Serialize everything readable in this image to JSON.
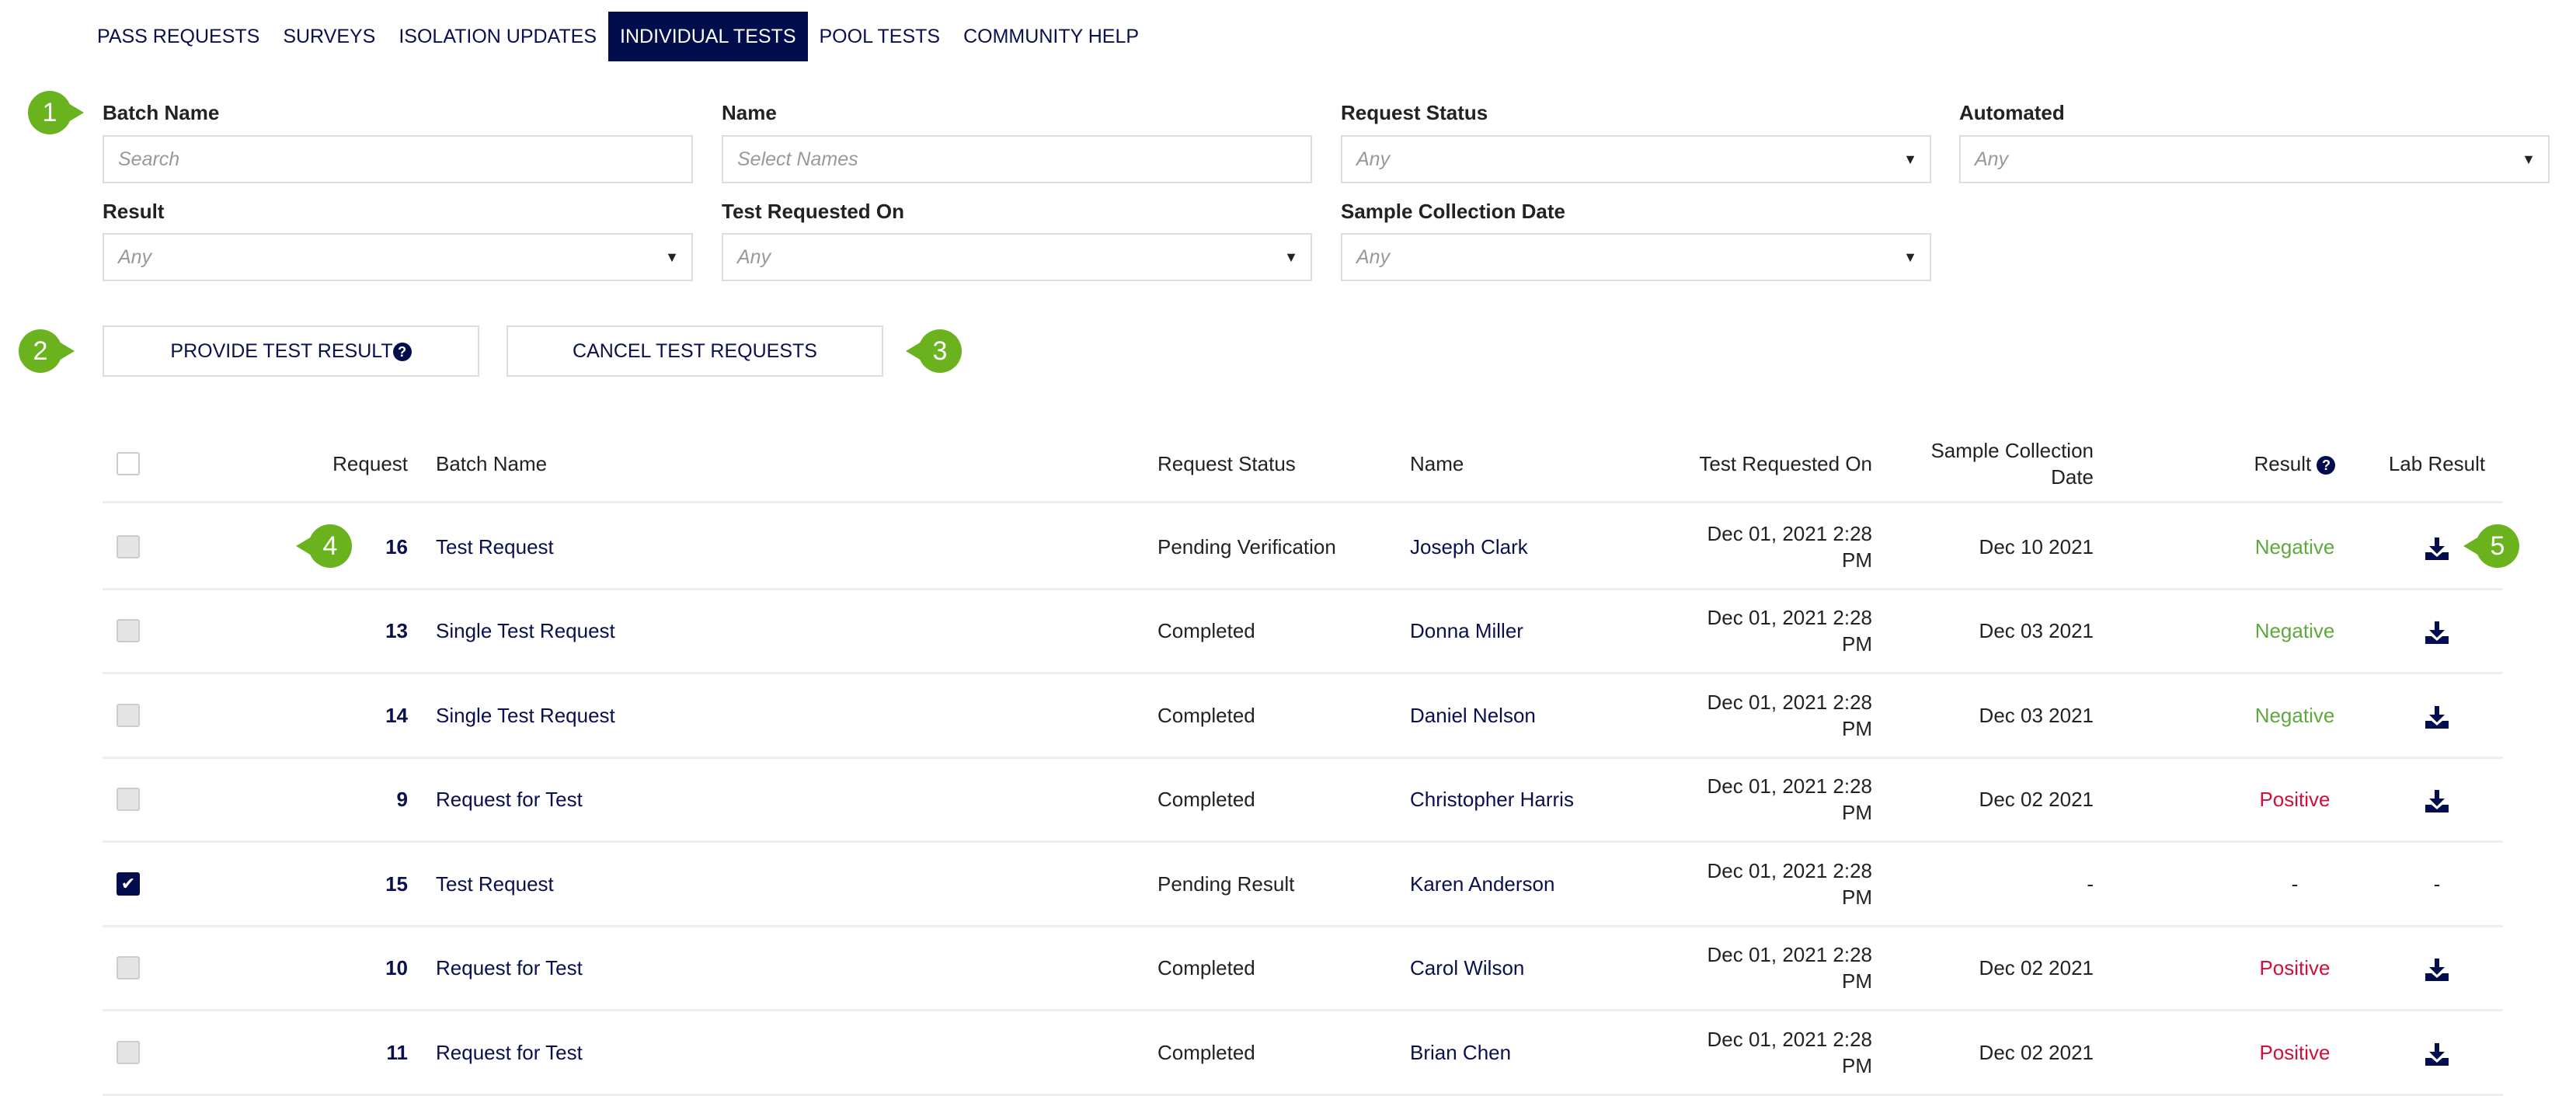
{
  "nav": {
    "tabs": [
      "PASS REQUESTS",
      "SURVEYS",
      "ISOLATION UPDATES",
      "INDIVIDUAL TESTS",
      "POOL TESTS",
      "COMMUNITY HELP"
    ],
    "active": 3
  },
  "filters": {
    "batch_name": {
      "label": "Batch Name",
      "placeholder": "Search"
    },
    "name": {
      "label": "Name",
      "placeholder": "Select Names"
    },
    "request_status": {
      "label": "Request Status",
      "value": "Any"
    },
    "automated": {
      "label": "Automated",
      "value": "Any"
    },
    "result": {
      "label": "Result",
      "value": "Any"
    },
    "test_requested_on": {
      "label": "Test Requested On",
      "value": "Any"
    },
    "sample_collection_date": {
      "label": "Sample Collection Date",
      "value": "Any"
    }
  },
  "actions": {
    "provide": "PROVIDE TEST RESULT",
    "cancel": "CANCEL TEST REQUESTS"
  },
  "callouts": [
    "1",
    "2",
    "3",
    "4",
    "5"
  ],
  "table": {
    "headers": {
      "request": "Request",
      "batch": "Batch Name",
      "status": "Request Status",
      "name": "Name",
      "requested": "Test Requested On",
      "sample": "Sample Collection Date",
      "result": "Result",
      "lab": "Lab Result"
    },
    "rows": [
      {
        "checked": false,
        "request": "16",
        "batch": "Test Request",
        "status": "Pending Verification",
        "name": "Joseph Clark",
        "requested": "Dec 01, 2021 2:28 PM",
        "sample": "Dec 10 2021",
        "result": "Negative",
        "lab": "download"
      },
      {
        "checked": false,
        "request": "13",
        "batch": "Single Test Request",
        "status": "Completed",
        "name": "Donna Miller",
        "requested": "Dec 01, 2021 2:28 PM",
        "sample": "Dec 03 2021",
        "result": "Negative",
        "lab": "download"
      },
      {
        "checked": false,
        "request": "14",
        "batch": "Single Test Request",
        "status": "Completed",
        "name": "Daniel Nelson",
        "requested": "Dec 01, 2021 2:28 PM",
        "sample": "Dec 03 2021",
        "result": "Negative",
        "lab": "download"
      },
      {
        "checked": false,
        "request": "9",
        "batch": "Request for Test",
        "status": "Completed",
        "name": "Christopher Harris",
        "requested": "Dec 01, 2021 2:28 PM",
        "sample": "Dec 02 2021",
        "result": "Positive",
        "lab": "download"
      },
      {
        "checked": true,
        "request": "15",
        "batch": "Test Request",
        "status": "Pending Result",
        "name": "Karen Anderson",
        "requested": "Dec 01, 2021 2:28 PM",
        "sample": "-",
        "result": "-",
        "lab": "-"
      },
      {
        "checked": false,
        "request": "10",
        "batch": "Request for Test",
        "status": "Completed",
        "name": "Carol Wilson",
        "requested": "Dec 01, 2021 2:28 PM",
        "sample": "Dec 02 2021",
        "result": "Positive",
        "lab": "download"
      },
      {
        "checked": false,
        "request": "11",
        "batch": "Request for Test",
        "status": "Completed",
        "name": "Brian Chen",
        "requested": "Dec 01, 2021 2:28 PM",
        "sample": "Dec 02 2021",
        "result": "Positive",
        "lab": "download"
      }
    ]
  },
  "colors": {
    "navy": "#020d4d",
    "negative": "#5fa83f",
    "positive": "#d0103a",
    "callout": "#6ab31f"
  }
}
